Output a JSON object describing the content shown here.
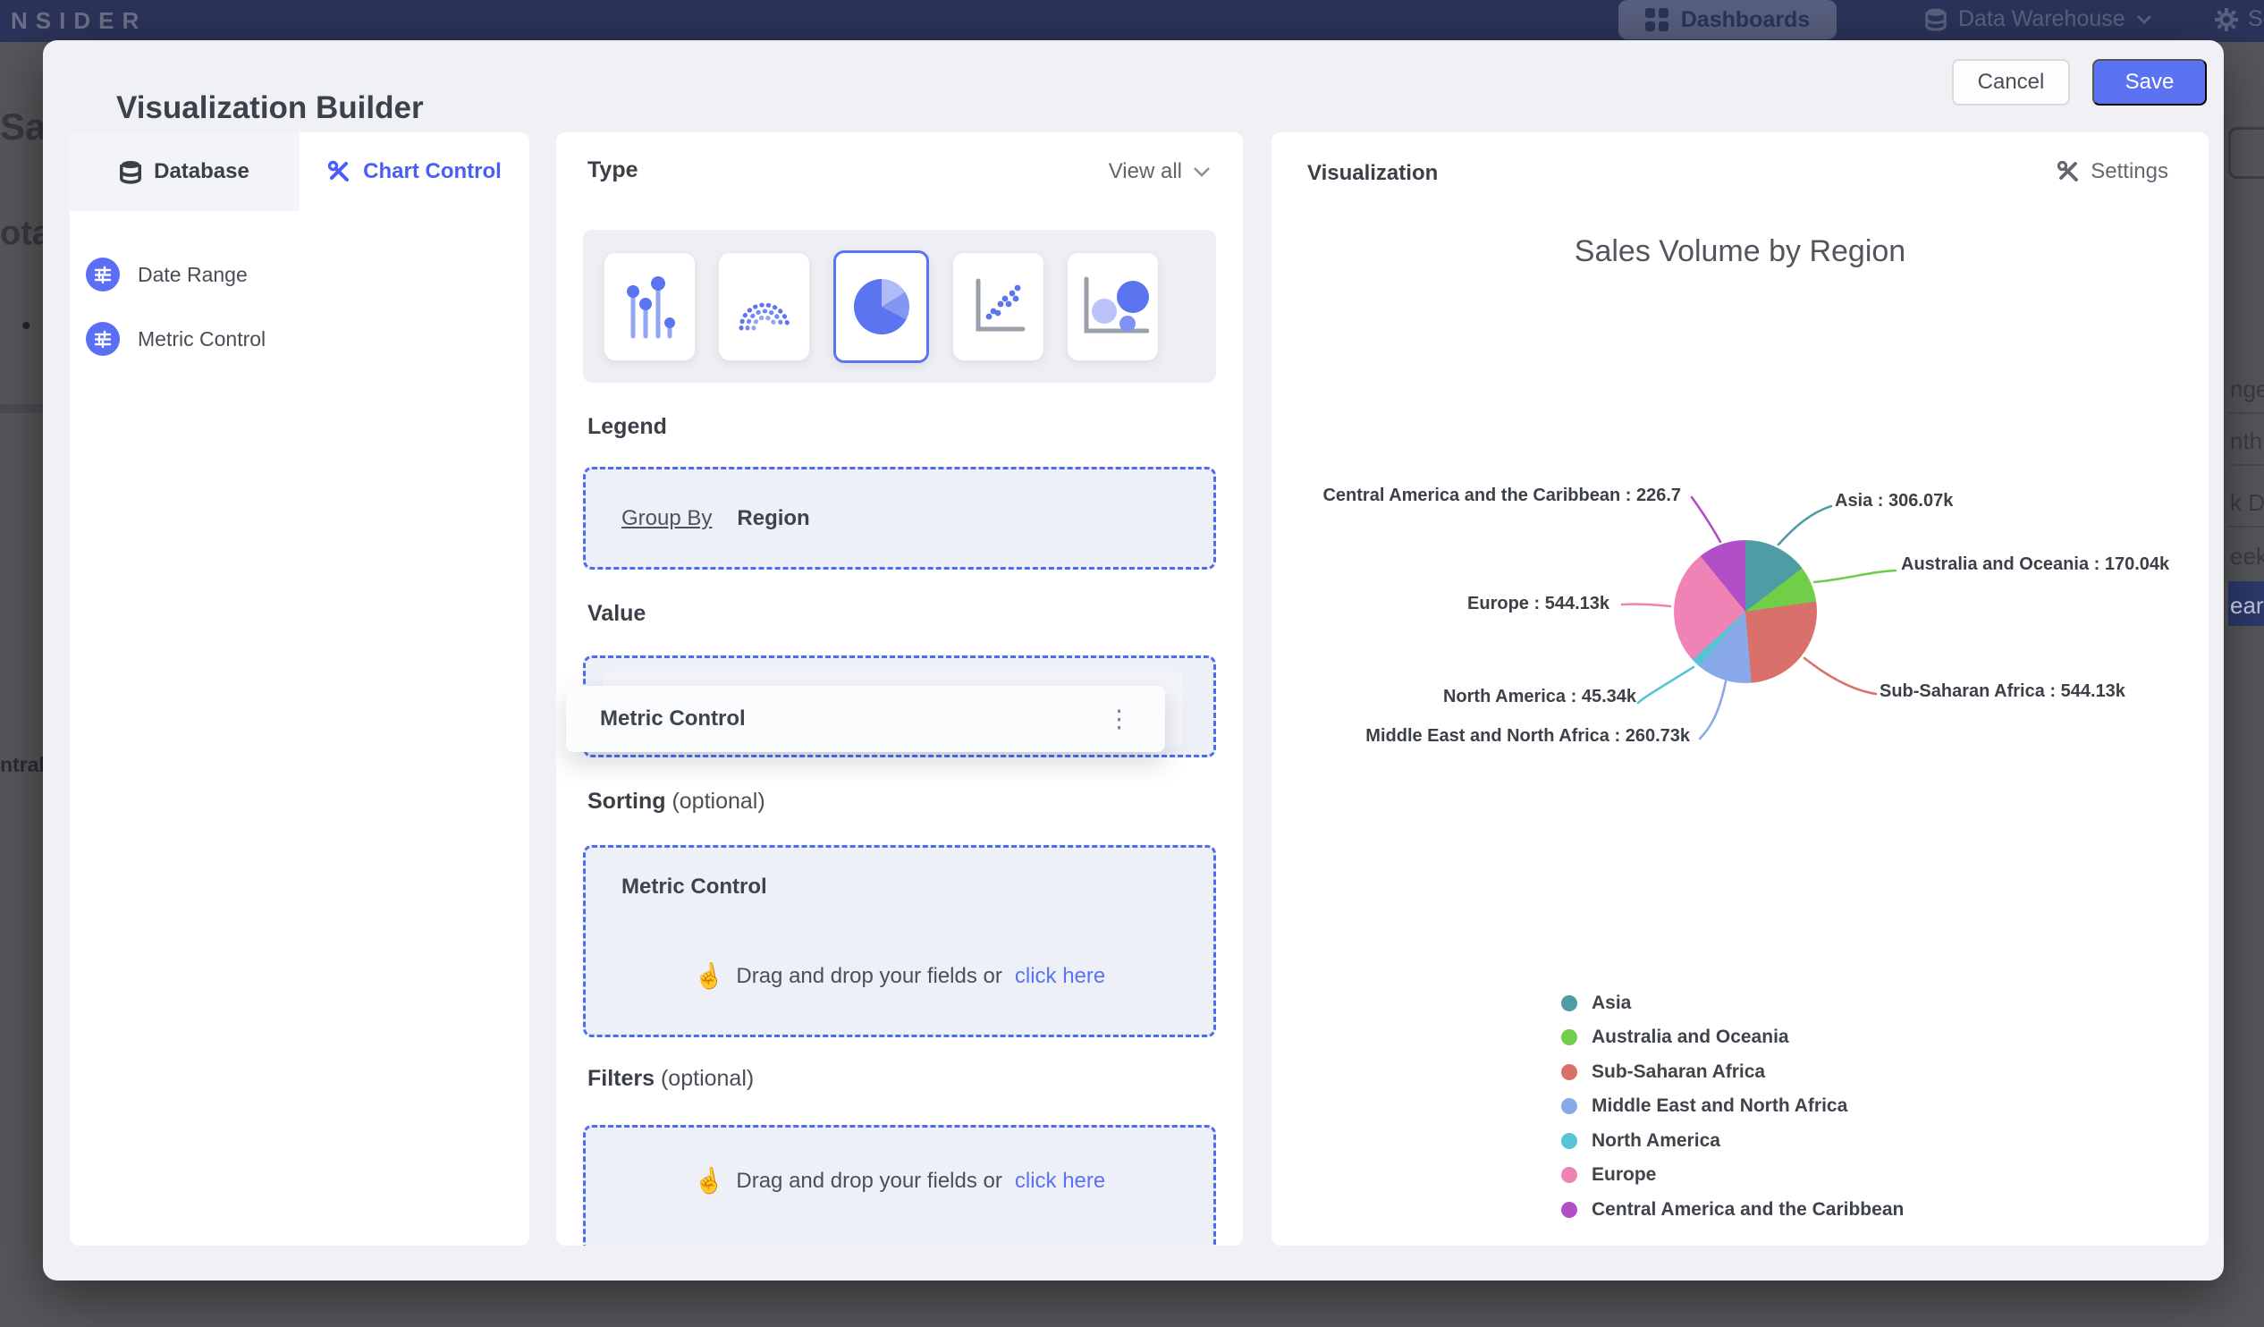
{
  "navbar": {
    "brand": "NSIDER",
    "dashboards_label": "Dashboards",
    "data_warehouse_label": "Data Warehouse",
    "settings_fragment": "Se"
  },
  "background": {
    "left_fragments": {
      "f1": "Sal",
      "f2": "ota",
      "f3": "ntral"
    },
    "right_fragments": {
      "f1": "nge",
      "f2": "nth",
      "f3": "k D",
      "f4": "eek",
      "f5": "ear"
    }
  },
  "modal": {
    "title": "Visualization Builder",
    "cancel_label": "Cancel",
    "save_label": "Save",
    "tabs": [
      {
        "label": "Database"
      },
      {
        "label": "Chart Control"
      }
    ],
    "sidebar_items": [
      {
        "label": "Date Range"
      },
      {
        "label": "Metric Control"
      }
    ],
    "type_section": {
      "title": "Type",
      "view_all": "View all"
    },
    "legend_section": {
      "title": "Legend",
      "group_by": "Group By",
      "value": "Region"
    },
    "value_section": {
      "title": "Value",
      "field": "Metric Control",
      "ghost_field": "Metric Control"
    },
    "sorting_section": {
      "title": "Sorting",
      "optional": "(optional)",
      "field": "Metric Control",
      "drop_text": "Drag and drop your fields or",
      "drop_link": "click here"
    },
    "filters_section": {
      "title": "Filters",
      "optional": "(optional)",
      "drop_text": "Drag and drop your fields or",
      "drop_link": "click here"
    },
    "viz_panel": {
      "title": "Visualization",
      "settings_label": "Settings"
    }
  },
  "icons": {
    "kebab": "⋮",
    "bullet": "•",
    "drag_hand": "☝"
  },
  "colors": {
    "accent": "#5b72f2",
    "tab_active": "#4a5ef5",
    "dashed_border": "#4d6bf2"
  },
  "chart_data": {
    "type": "pie",
    "title": "Sales Volume by Region",
    "unit": "k",
    "legend_position": "bottom-left",
    "series": [
      {
        "name": "Asia",
        "value": 306.07,
        "color": "#4E9DA4",
        "callout": "Asia : 306.07k"
      },
      {
        "name": "Australia and Oceania",
        "value": 170.04,
        "color": "#70CE49",
        "callout": "Australia and Oceania : 170.04k"
      },
      {
        "name": "Sub-Saharan Africa",
        "value": 544.13,
        "color": "#D9706C",
        "callout": "Sub-Saharan Africa : 544.13k"
      },
      {
        "name": "Middle East and North Africa",
        "value": 260.73,
        "color": "#8AA9E8",
        "callout": "Middle East and North Africa : 260.73k"
      },
      {
        "name": "North America",
        "value": 45.34,
        "color": "#56C4D6",
        "callout": "North America : 45.34k"
      },
      {
        "name": "Europe",
        "value": 544.13,
        "color": "#F083B5",
        "callout": "Europe : 544.13k"
      },
      {
        "name": "Central America and the Caribbean",
        "value": 226.77,
        "color": "#B04FC6",
        "callout": "Central America and the Caribbean : 226.7"
      }
    ]
  }
}
